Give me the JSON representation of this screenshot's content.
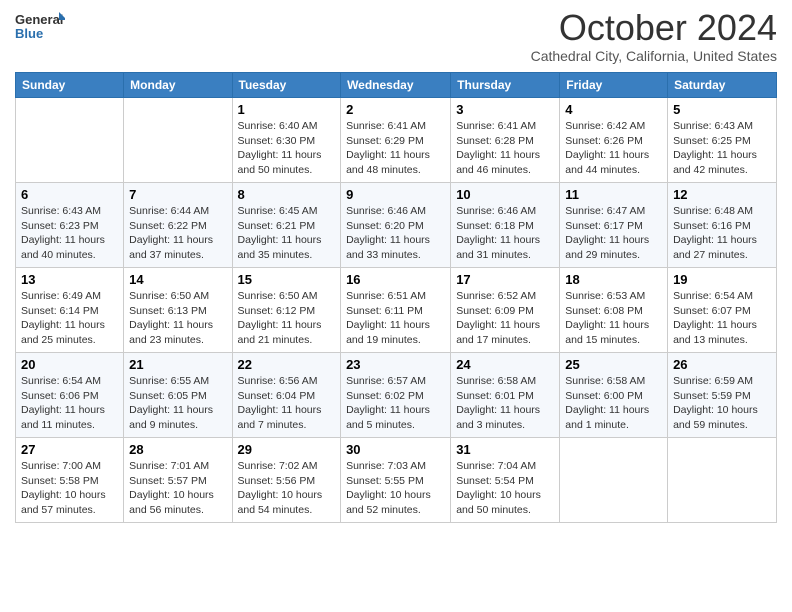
{
  "header": {
    "logo_general": "General",
    "logo_blue": "Blue",
    "month_title": "October 2024",
    "location": "Cathedral City, California, United States"
  },
  "days_of_week": [
    "Sunday",
    "Monday",
    "Tuesday",
    "Wednesday",
    "Thursday",
    "Friday",
    "Saturday"
  ],
  "weeks": [
    [
      {
        "day": "",
        "info": ""
      },
      {
        "day": "",
        "info": ""
      },
      {
        "day": "1",
        "info": "Sunrise: 6:40 AM\nSunset: 6:30 PM\nDaylight: 11 hours and 50 minutes."
      },
      {
        "day": "2",
        "info": "Sunrise: 6:41 AM\nSunset: 6:29 PM\nDaylight: 11 hours and 48 minutes."
      },
      {
        "day": "3",
        "info": "Sunrise: 6:41 AM\nSunset: 6:28 PM\nDaylight: 11 hours and 46 minutes."
      },
      {
        "day": "4",
        "info": "Sunrise: 6:42 AM\nSunset: 6:26 PM\nDaylight: 11 hours and 44 minutes."
      },
      {
        "day": "5",
        "info": "Sunrise: 6:43 AM\nSunset: 6:25 PM\nDaylight: 11 hours and 42 minutes."
      }
    ],
    [
      {
        "day": "6",
        "info": "Sunrise: 6:43 AM\nSunset: 6:23 PM\nDaylight: 11 hours and 40 minutes."
      },
      {
        "day": "7",
        "info": "Sunrise: 6:44 AM\nSunset: 6:22 PM\nDaylight: 11 hours and 37 minutes."
      },
      {
        "day": "8",
        "info": "Sunrise: 6:45 AM\nSunset: 6:21 PM\nDaylight: 11 hours and 35 minutes."
      },
      {
        "day": "9",
        "info": "Sunrise: 6:46 AM\nSunset: 6:20 PM\nDaylight: 11 hours and 33 minutes."
      },
      {
        "day": "10",
        "info": "Sunrise: 6:46 AM\nSunset: 6:18 PM\nDaylight: 11 hours and 31 minutes."
      },
      {
        "day": "11",
        "info": "Sunrise: 6:47 AM\nSunset: 6:17 PM\nDaylight: 11 hours and 29 minutes."
      },
      {
        "day": "12",
        "info": "Sunrise: 6:48 AM\nSunset: 6:16 PM\nDaylight: 11 hours and 27 minutes."
      }
    ],
    [
      {
        "day": "13",
        "info": "Sunrise: 6:49 AM\nSunset: 6:14 PM\nDaylight: 11 hours and 25 minutes."
      },
      {
        "day": "14",
        "info": "Sunrise: 6:50 AM\nSunset: 6:13 PM\nDaylight: 11 hours and 23 minutes."
      },
      {
        "day": "15",
        "info": "Sunrise: 6:50 AM\nSunset: 6:12 PM\nDaylight: 11 hours and 21 minutes."
      },
      {
        "day": "16",
        "info": "Sunrise: 6:51 AM\nSunset: 6:11 PM\nDaylight: 11 hours and 19 minutes."
      },
      {
        "day": "17",
        "info": "Sunrise: 6:52 AM\nSunset: 6:09 PM\nDaylight: 11 hours and 17 minutes."
      },
      {
        "day": "18",
        "info": "Sunrise: 6:53 AM\nSunset: 6:08 PM\nDaylight: 11 hours and 15 minutes."
      },
      {
        "day": "19",
        "info": "Sunrise: 6:54 AM\nSunset: 6:07 PM\nDaylight: 11 hours and 13 minutes."
      }
    ],
    [
      {
        "day": "20",
        "info": "Sunrise: 6:54 AM\nSunset: 6:06 PM\nDaylight: 11 hours and 11 minutes."
      },
      {
        "day": "21",
        "info": "Sunrise: 6:55 AM\nSunset: 6:05 PM\nDaylight: 11 hours and 9 minutes."
      },
      {
        "day": "22",
        "info": "Sunrise: 6:56 AM\nSunset: 6:04 PM\nDaylight: 11 hours and 7 minutes."
      },
      {
        "day": "23",
        "info": "Sunrise: 6:57 AM\nSunset: 6:02 PM\nDaylight: 11 hours and 5 minutes."
      },
      {
        "day": "24",
        "info": "Sunrise: 6:58 AM\nSunset: 6:01 PM\nDaylight: 11 hours and 3 minutes."
      },
      {
        "day": "25",
        "info": "Sunrise: 6:58 AM\nSunset: 6:00 PM\nDaylight: 11 hours and 1 minute."
      },
      {
        "day": "26",
        "info": "Sunrise: 6:59 AM\nSunset: 5:59 PM\nDaylight: 10 hours and 59 minutes."
      }
    ],
    [
      {
        "day": "27",
        "info": "Sunrise: 7:00 AM\nSunset: 5:58 PM\nDaylight: 10 hours and 57 minutes."
      },
      {
        "day": "28",
        "info": "Sunrise: 7:01 AM\nSunset: 5:57 PM\nDaylight: 10 hours and 56 minutes."
      },
      {
        "day": "29",
        "info": "Sunrise: 7:02 AM\nSunset: 5:56 PM\nDaylight: 10 hours and 54 minutes."
      },
      {
        "day": "30",
        "info": "Sunrise: 7:03 AM\nSunset: 5:55 PM\nDaylight: 10 hours and 52 minutes."
      },
      {
        "day": "31",
        "info": "Sunrise: 7:04 AM\nSunset: 5:54 PM\nDaylight: 10 hours and 50 minutes."
      },
      {
        "day": "",
        "info": ""
      },
      {
        "day": "",
        "info": ""
      }
    ]
  ]
}
